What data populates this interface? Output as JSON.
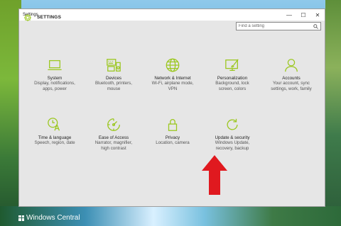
{
  "window": {
    "title": "Settings",
    "controls": {
      "minimize": "—",
      "maximize": "☐",
      "close": "✕"
    }
  },
  "header": {
    "title": "SETTINGS",
    "icon": "gear-icon"
  },
  "search": {
    "placeholder": "Find a setting",
    "value": ""
  },
  "tiles": [
    {
      "title": "System",
      "desc": "Display, notifications,\napps, power",
      "icon": "laptop-icon"
    },
    {
      "title": "Devices",
      "desc": "Bluetooth, printers,\nmouse",
      "icon": "keyboard-speaker-icon"
    },
    {
      "title": "Network & Internet",
      "desc": "Wi-Fi, airplane mode,\nVPN",
      "icon": "globe-icon"
    },
    {
      "title": "Personalization",
      "desc": "Background, lock\nscreen, colors",
      "icon": "paintbrush-monitor-icon"
    },
    {
      "title": "Accounts",
      "desc": "Your account, sync\nsettings, work, family",
      "icon": "person-icon"
    },
    {
      "title": "Time & language",
      "desc": "Speech, region, date",
      "icon": "clock-language-icon"
    },
    {
      "title": "Ease of Access",
      "desc": "Narrator, magnifier,\nhigh contrast",
      "icon": "ease-of-access-icon"
    },
    {
      "title": "Privacy",
      "desc": "Location, camera",
      "icon": "lock-icon"
    },
    {
      "title": "Update & security",
      "desc": "Windows Update,\nrecovery, backup",
      "icon": "refresh-icon"
    }
  ],
  "watermark": "Windows Central",
  "colors": {
    "accent": "#9bc71f",
    "arrow": "#e0191f",
    "window_bg": "#e6e6e6"
  }
}
